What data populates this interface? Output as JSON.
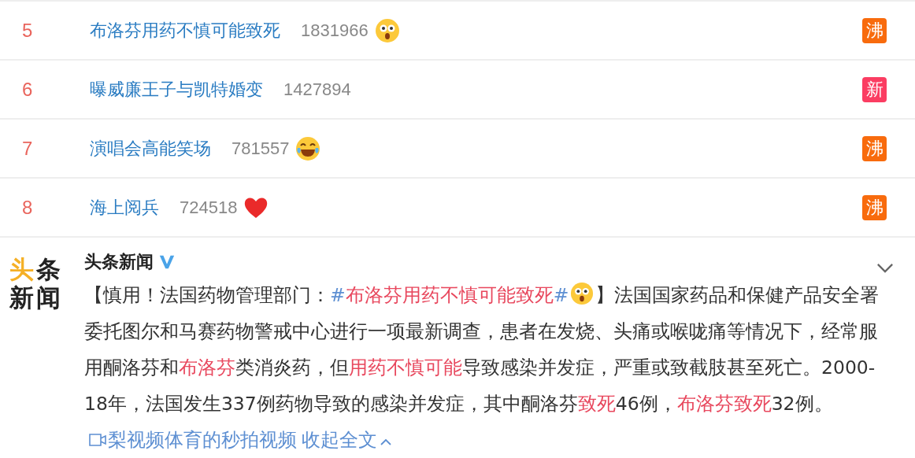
{
  "hot_list": [
    {
      "rank": "5",
      "title": "布洛芬用药不慎可能致死",
      "count": "1831966",
      "kind": "surprised",
      "badge": {
        "label": "沸",
        "color": "#f86b0d"
      }
    },
    {
      "rank": "6",
      "title": "曝威廉王子与凯特婚变",
      "count": "1427894",
      "kind": "plain",
      "badge": {
        "label": "新",
        "color": "#fb3d62"
      }
    },
    {
      "rank": "7",
      "title": "演唱会高能笑场",
      "count": "781557",
      "kind": "laughing",
      "badge": {
        "label": "沸",
        "color": "#f86b0d"
      }
    },
    {
      "rank": "8",
      "title": "海上阅兵",
      "count": "724518",
      "kind": "heart",
      "badge": {
        "label": "沸",
        "color": "#f86b0d"
      }
    }
  ],
  "post": {
    "logo": [
      "头",
      "条",
      "新",
      "闻"
    ],
    "author": "头条新闻",
    "verified": true,
    "body": [
      {
        "kind": "plain",
        "text": "【慎用！法国药物管理部门："
      },
      {
        "kind": "hash",
        "text": "#"
      },
      {
        "kind": "highlight",
        "text": "布洛芬用药不慎可能致死"
      },
      {
        "kind": "hash",
        "text": "#"
      },
      {
        "kind": "surprised_emoji"
      },
      {
        "kind": "plain",
        "text": "】法国国家药品和保健产品安全署委托图尔和马赛药物警戒中心进行一项最新调查，患者在发烧、头痛或喉咙痛等情况下，经常服用酮洛芬和"
      },
      {
        "kind": "highlight",
        "text": "布洛芬"
      },
      {
        "kind": "plain",
        "text": "类消炎药，但"
      },
      {
        "kind": "highlight",
        "text": "用药不慎可能"
      },
      {
        "kind": "plain",
        "text": "导致感染并发症，严重或致截肢甚至死亡。2000-18年，法国发生337例药物导致的感染并发症，其中酮洛芬"
      },
      {
        "kind": "highlight",
        "text": "致死"
      },
      {
        "kind": "plain",
        "text": "46例，"
      },
      {
        "kind": "highlight",
        "text": "布洛芬致死"
      },
      {
        "kind": "plain",
        "text": "32例。"
      },
      {
        "kind": "video_link",
        "text": "梨视频体育的秒拍视频"
      },
      {
        "kind": "collapse_link",
        "text": "收起全文"
      }
    ]
  }
}
